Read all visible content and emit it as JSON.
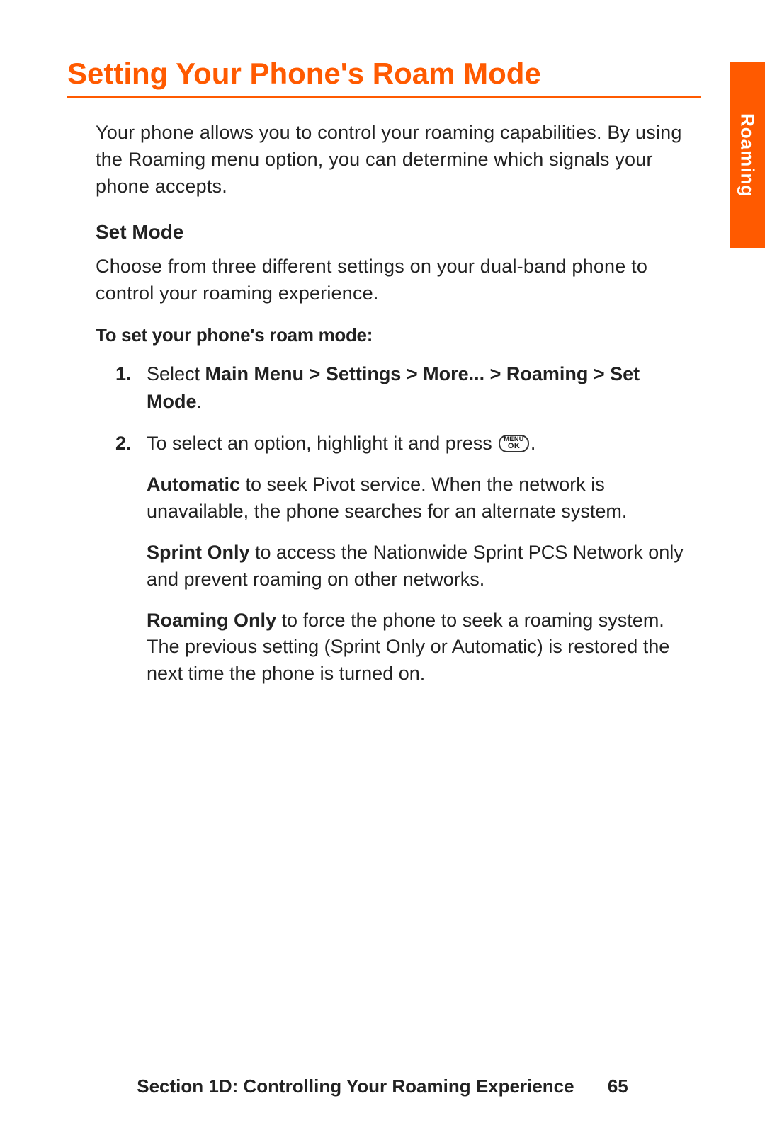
{
  "title": "Setting Your Phone's Roam Mode",
  "intro": "Your phone allows you to control your roaming capabilities. By using the Roaming menu option, you can determine which signals your phone accepts.",
  "set_mode_heading": "Set Mode",
  "set_mode_para": "Choose from three different settings on your dual-band phone to control your roaming experience.",
  "procedure_heading": "To set your phone's roam mode:",
  "steps": {
    "s1_num": "1.",
    "s1_pre": "Select ",
    "s1_bold": "Main Menu > Settings > More... > Roaming > Set Mode",
    "s1_post": ".",
    "s2_num": "2.",
    "s2_pre": "To select an option, highlight it and press ",
    "s2_post": "."
  },
  "button_icon": {
    "top": "MENU",
    "bottom": "OK"
  },
  "options": {
    "auto_label": "Automatic",
    "auto_text": " to seek Pivot service. When the network is unavailable, the phone searches for an alternate system.",
    "sprint_label": "Sprint Only",
    "sprint_text": " to access the Nationwide Sprint PCS Network only and prevent roaming on other networks.",
    "roam_label": "Roaming Only",
    "roam_text": " to force the phone to seek a roaming system. The previous setting (Sprint Only or Automatic) is restored the next time the phone is turned on."
  },
  "side_tab": "Roaming",
  "footer_section": "Section 1D: Controlling Your Roaming Experience",
  "footer_page": "65"
}
